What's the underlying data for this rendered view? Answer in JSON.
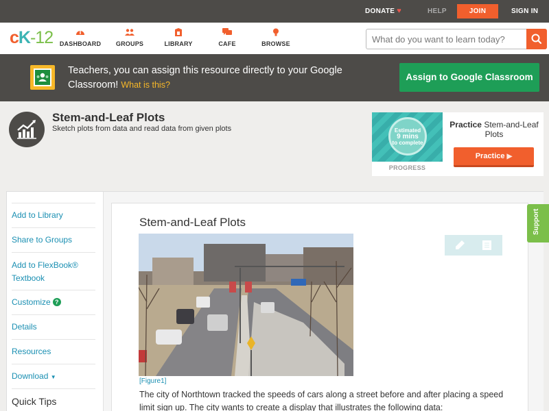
{
  "topbar": {
    "donate": "DONATE",
    "help": "HELP",
    "join": "JOIN",
    "signin": "SIGN IN"
  },
  "logo": {
    "c": "c",
    "k": "K",
    "n": "-12"
  },
  "nav": {
    "items": [
      {
        "label": "DASHBOARD",
        "icon": "dashboard-icon"
      },
      {
        "label": "GROUPS",
        "icon": "groups-icon"
      },
      {
        "label": "LIBRARY",
        "icon": "library-icon"
      },
      {
        "label": "CAFE",
        "icon": "cafe-icon"
      },
      {
        "label": "BROWSE",
        "icon": "browse-icon"
      }
    ],
    "search_placeholder": "What do you want to learn today?"
  },
  "classroom": {
    "text": "Teachers, you can assign this resource directly to your Google Classroom!",
    "what": "What is this?",
    "button": "Assign to Google Classroom"
  },
  "topic": {
    "title": "Stem-and-Leaf Plots",
    "subtitle": "Sketch plots from data and read data from given plots"
  },
  "practice_card": {
    "estimated": "Estimated",
    "mins": "9 mins",
    "to_complete": "to complete",
    "progress_label": "PROGRESS",
    "practice_word": "Practice",
    "practice_topic": "Stem-and-Leaf Plots",
    "button": "Practice"
  },
  "sidebar": {
    "items": [
      {
        "label": "Add to Library"
      },
      {
        "label": "Share to Groups"
      },
      {
        "label": "Add to FlexBook® Textbook"
      },
      {
        "label": "Customize"
      },
      {
        "label": "Details"
      },
      {
        "label": "Resources"
      },
      {
        "label": "Download"
      }
    ],
    "quick_tips": "Quick Tips"
  },
  "article": {
    "title": "Stem-and-Leaf Plots",
    "figure_caption": "[Figure1]",
    "text": "The city of Northtown tracked the speeds of cars along a street before and after placing a speed limit sign up. The city wants to create a display that illustrates the following data:"
  },
  "support": "Support",
  "colors": {
    "brand_orange": "#f15f2d",
    "brand_teal": "#3cb4b4",
    "brand_green": "#7bbf4a",
    "dark_bar": "#4d4b48",
    "classroom_green": "#1e9e57",
    "link_blue": "#1a8fb2"
  }
}
